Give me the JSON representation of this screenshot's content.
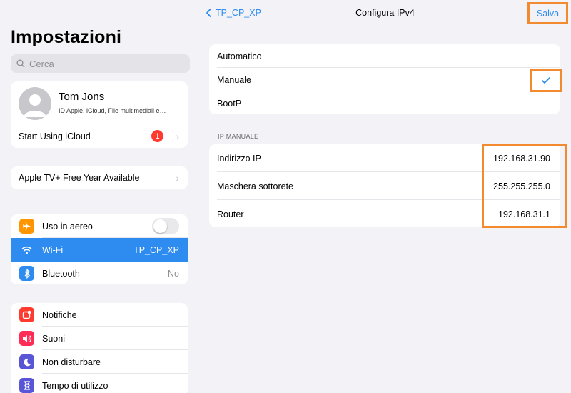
{
  "sidebar": {
    "title": "Impostazioni",
    "search_placeholder": "Cerca",
    "profile": {
      "name": "Tom Jons",
      "subtitle": "ID Apple, iCloud, File multimediali e…"
    },
    "icloud": {
      "label": "Start Using iCloud",
      "badge": "1"
    },
    "appletv": {
      "label": "Apple TV+ Free Year Available"
    },
    "network": [
      {
        "label": "Uso in aereo",
        "icon": "airplane-icon",
        "color": "#ff9500",
        "toggle": false
      },
      {
        "label": "Wi-Fi",
        "value": "TP_CP_XP",
        "icon": "wifi-icon",
        "color": "#2e8cf0",
        "selected": true
      },
      {
        "label": "Bluetooth",
        "value": "No",
        "icon": "bluetooth-icon",
        "color": "#2e8cf0"
      }
    ],
    "system": [
      {
        "label": "Notifiche",
        "icon": "notifications-icon",
        "color": "#ff3b30"
      },
      {
        "label": "Suoni",
        "icon": "sounds-icon",
        "color": "#ff2d55"
      },
      {
        "label": "Non disturbare",
        "icon": "moon-icon",
        "color": "#5856d6"
      },
      {
        "label": "Tempo di utilizzo",
        "icon": "hourglass-icon",
        "color": "#5856d6"
      }
    ]
  },
  "nav": {
    "back_label": "TP_CP_XP",
    "title": "Configura IPv4",
    "save_label": "Salva"
  },
  "modes": [
    {
      "label": "Automatico",
      "checked": false
    },
    {
      "label": "Manuale",
      "checked": true
    },
    {
      "label": "BootP",
      "checked": false
    }
  ],
  "manual_ip": {
    "header": "IP MANUALE",
    "rows": [
      {
        "label": "Indirizzo IP",
        "value": "192.168.31.90"
      },
      {
        "label": "Maschera sottorete",
        "value": "255.255.255.0"
      },
      {
        "label": "Router",
        "value": "192.168.31.1"
      }
    ]
  },
  "colors": {
    "accent": "#2e8cf0",
    "highlight": "#f28a30"
  }
}
